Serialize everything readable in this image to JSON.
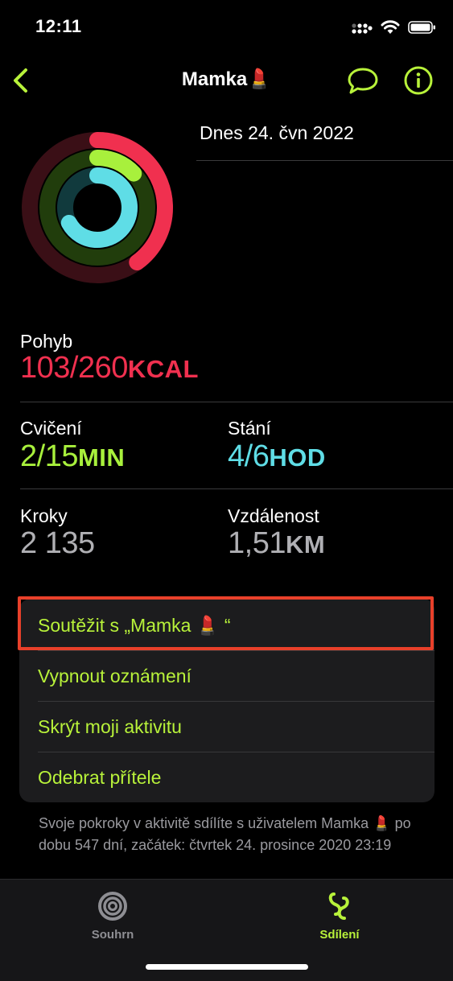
{
  "status_bar": {
    "time": "12:11"
  },
  "nav": {
    "title": "Mamka",
    "title_emoji": "💄",
    "back_icon": "chevron-left-icon",
    "message_icon": "speech-bubble-icon",
    "info_icon": "info-icon"
  },
  "date": "Dnes 24. čvn 2022",
  "colors": {
    "accent": "#b8f23a",
    "move": "#f0304f",
    "exercise": "#a8f03c",
    "stand": "#5fdde6",
    "neutral": "#b0b0b4"
  },
  "rings": {
    "move_fraction": 0.4,
    "exercise_fraction": 0.13,
    "stand_fraction": 0.67
  },
  "metrics": {
    "move": {
      "label": "Pohyb",
      "value": "103/260",
      "unit": "KCAL"
    },
    "exercise": {
      "label": "Cvičení",
      "value": "2/15",
      "unit": "MIN"
    },
    "stand": {
      "label": "Stání",
      "value": "4/6",
      "unit": "HOD"
    },
    "steps": {
      "label": "Kroky",
      "value": "2 135",
      "unit": ""
    },
    "distance": {
      "label": "Vzdálenost",
      "value": "1,51",
      "unit": "KM"
    }
  },
  "menu": {
    "compete": "Soutěžit s „Mamka 💄 “",
    "mute": "Vypnout oznámení",
    "hide": "Skrýt moji aktivitu",
    "remove": "Odebrat přítele"
  },
  "footer_note": "Svoje pokroky v aktivitě sdílíte s uživatelem Mamka 💄 po dobu 547 dní, začátek: čtvrtek 24. prosince 2020 23:19",
  "tabs": [
    {
      "label": "Souhrn",
      "icon": "summary-rings-icon",
      "active": false
    },
    {
      "label": "Sdílení",
      "icon": "sharing-icon",
      "active": true
    }
  ]
}
